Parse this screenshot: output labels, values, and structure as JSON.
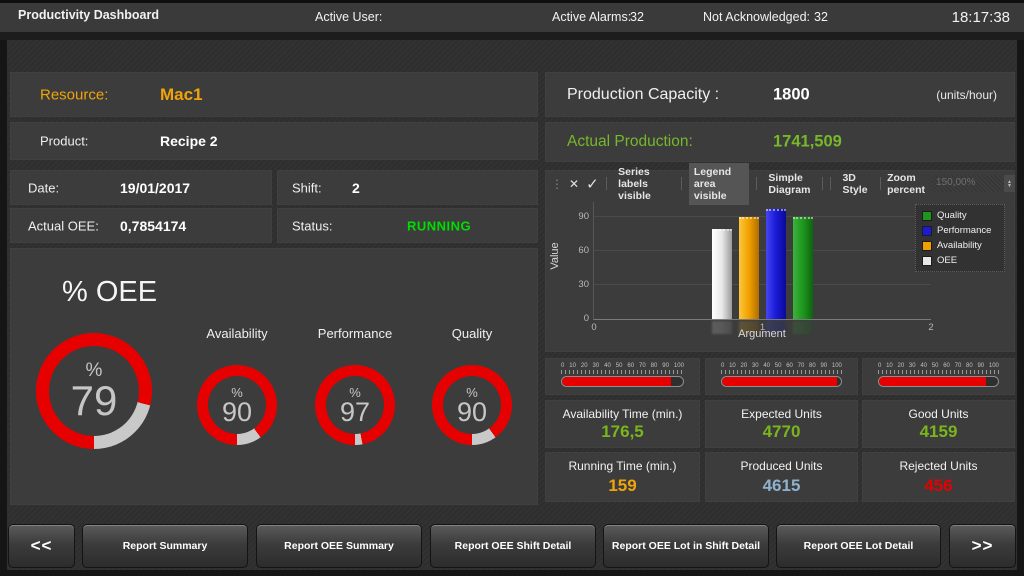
{
  "header": {
    "title": "Productivity Dashboard",
    "active_user_label": "Active User:",
    "active_alarms_label": "Active Alarms:",
    "active_alarms_value": "32",
    "not_acknowledged_label": "Not Acknowledged:",
    "not_acknowledged_value": "32",
    "clock": "18:17:38"
  },
  "left": {
    "resource_label": "Resource:",
    "resource_value": "Mac1",
    "product_label": "Product:",
    "product_value": "Recipe 2",
    "date_label": "Date:",
    "date_value": "19/01/2017",
    "shift_label": "Shift:",
    "shift_value": "2",
    "actual_oee_label": "Actual OEE:",
    "actual_oee_value": "0,7854174",
    "status_label": "Status:",
    "status_value": "RUNNING",
    "status_color": "#00dd00",
    "oee_title": "% OEE",
    "percent_sign": "%",
    "gauge_colors": {
      "fill": "#e60000",
      "rest": "#c9c9c9"
    },
    "gauges": [
      {
        "name": "OEE",
        "label": "",
        "value": 79
      },
      {
        "name": "Availability",
        "label": "Availability",
        "value": 90
      },
      {
        "name": "Performance",
        "label": "Performance",
        "value": 97
      },
      {
        "name": "Quality",
        "label": "Quality",
        "value": 90
      }
    ]
  },
  "right": {
    "capacity_label": "Production Capacity :",
    "capacity_value": "1800",
    "capacity_units": "(units/hour)",
    "production_label": "Actual Production:",
    "production_value": "1741,509",
    "production_color": "#76b82a",
    "toolbar": {
      "icons": {
        "drag_handle": "⋮",
        "close": "✕",
        "check": "✓",
        "spin_up": "▲",
        "spin_down": "▼"
      },
      "buttons": [
        "Series labels visible",
        "Legend area visible",
        "Simple Diagram",
        "3D Style"
      ],
      "active_button": "Legend area visible",
      "zoom_label": "Zoom percent",
      "zoom_value": "150,00%"
    },
    "linear_gauges": {
      "ticks": [
        0,
        10,
        20,
        30,
        40,
        50,
        60,
        70,
        80,
        90,
        100
      ],
      "values": [
        90,
        97,
        90
      ],
      "bar_color": "#e60000"
    },
    "tiles": [
      {
        "label": "Availability Time (min.)",
        "value": "176,5",
        "color": "#7ab51d"
      },
      {
        "label": "Expected Units",
        "value": "4770",
        "color": "#7ab51d"
      },
      {
        "label": "Good Units",
        "value": "4159",
        "color": "#7ab51d"
      },
      {
        "label": "Running Time (min.)",
        "value": "159",
        "color": "#f0a30a"
      },
      {
        "label": "Produced Units",
        "value": "4615",
        "color": "#8fb2cc"
      },
      {
        "label": "Rejected Units",
        "value": "456",
        "color": "#e60000"
      }
    ]
  },
  "chart_data": {
    "type": "bar",
    "style": "3d",
    "x": [
      1
    ],
    "series": [
      {
        "name": "OEE",
        "values": [
          79
        ],
        "color": "#e8e8e8",
        "color_light": "#ffffff",
        "color_dark": "#9a9a9a"
      },
      {
        "name": "Availability",
        "values": [
          90
        ],
        "color": "#f0a000",
        "color_light": "#ffc63c",
        "color_dark": "#b06e00"
      },
      {
        "name": "Performance",
        "values": [
          97
        ],
        "color": "#1a1ad8",
        "color_light": "#4646f0",
        "color_dark": "#0a0a96"
      },
      {
        "name": "Quality",
        "values": [
          90
        ],
        "color": "#1e961e",
        "color_light": "#3cb43c",
        "color_dark": "#0e640e"
      }
    ],
    "legend_order": [
      "Quality",
      "Performance",
      "Availability",
      "OEE"
    ],
    "legend_position": "right",
    "title": "",
    "xlabel": "Argument",
    "ylabel": "Value",
    "xticks": [
      0,
      1,
      2
    ],
    "yticks": [
      0,
      30,
      60,
      90
    ],
    "xlim": [
      0,
      2
    ],
    "ylim": [
      0,
      103
    ],
    "grid": true
  },
  "footer": {
    "buttons": [
      "<<",
      "Report Summary",
      "Report OEE Summary",
      "Report OEE Shift Detail",
      "Report OEE Lot in Shift Detail",
      "Report OEE Lot Detail",
      ">>"
    ]
  }
}
